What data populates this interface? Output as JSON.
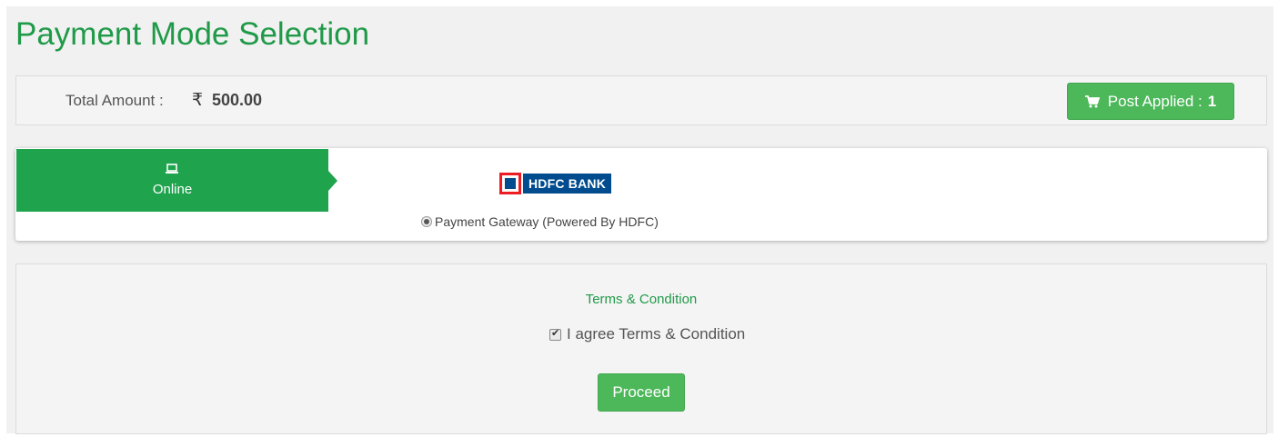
{
  "page": {
    "title": "Payment Mode Selection"
  },
  "summary": {
    "total_label": "Total Amount :",
    "currency_symbol": "₹",
    "total_value": "500.00",
    "post_applied_label": "Post Applied :",
    "post_applied_count": "1",
    "post_icon": "cart-icon"
  },
  "payment_modes": {
    "active_tab": {
      "icon": "laptop-icon",
      "label": "Online"
    },
    "bank_logo_text": "HDFC BANK",
    "option_label": "Payment Gateway (Powered By HDFC)",
    "option_selected": true
  },
  "terms": {
    "title": "Terms & Condition",
    "agree_label": "I agree Terms & Condition",
    "agree_checked": true,
    "proceed_label": "Proceed"
  },
  "colors": {
    "brand_green": "#1fa34d",
    "button_green": "#4cb85a",
    "bank_blue": "#004c8f",
    "bank_red": "#ed1c24"
  }
}
